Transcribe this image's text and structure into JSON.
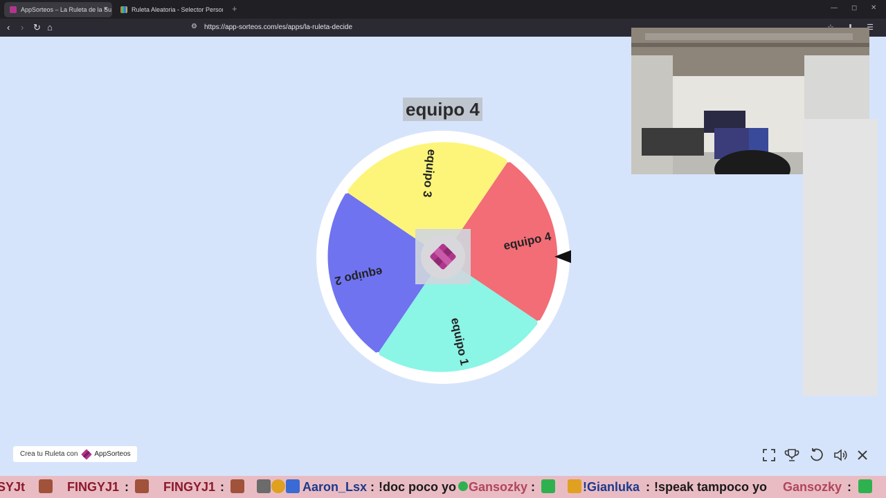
{
  "browser": {
    "tabs": [
      {
        "label": "AppSorteos – La Ruleta de la Su",
        "active": true
      },
      {
        "label": "Ruleta Aleatoria - Selector Personaliz",
        "active": false
      }
    ],
    "new_tab": "+",
    "url": "https://app-sorteos.com/es/apps/la-ruleta-decide"
  },
  "wheel": {
    "result_label": "equipo 4",
    "segments": [
      {
        "label": "equipo 3",
        "color": "#fdf57a"
      },
      {
        "label": "equipo 4",
        "color": "#f26d76"
      },
      {
        "label": "equipo 1",
        "color": "#8bf5e6"
      },
      {
        "label": "equipo 2",
        "color": "#6f73f0"
      }
    ],
    "center_icon": "appsorteos-logo-icon",
    "pointer_icon": "pointer-icon"
  },
  "footer": {
    "badge_text": "Crea tu Ruleta con",
    "badge_brand": "AppSorteos",
    "controls": [
      "fullscreen-icon",
      "trophy-icon",
      "reset-icon",
      "volume-icon",
      "close-icon"
    ]
  },
  "ticker": {
    "items": [
      "SYJt",
      "FINGYJ1",
      ":",
      "FINGYJ1",
      ":",
      "Aaron_Lsx",
      ":",
      "!doc poco yo",
      "Gansozky",
      ":",
      "!Gianluka",
      ":",
      "!speak tampoco yo",
      "Gansozky",
      ":"
    ]
  },
  "colors": {
    "background": "#d6e4fb",
    "brand": "#b0368c"
  }
}
